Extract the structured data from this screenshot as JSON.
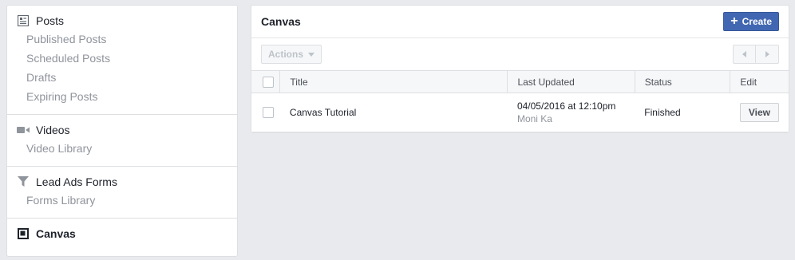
{
  "sidebar": {
    "sections": [
      {
        "icon": "posts-icon",
        "label": "Posts",
        "items": [
          "Published Posts",
          "Scheduled Posts",
          "Drafts",
          "Expiring Posts"
        ]
      },
      {
        "icon": "video-camera-icon",
        "label": "Videos",
        "items": [
          "Video Library"
        ]
      },
      {
        "icon": "funnel-icon",
        "label": "Lead Ads Forms",
        "items": [
          "Forms Library"
        ]
      },
      {
        "icon": "canvas-icon",
        "label": "Canvas",
        "items": []
      }
    ]
  },
  "main": {
    "title": "Canvas",
    "create_label": "Create",
    "actions_label": "Actions",
    "table": {
      "columns": [
        "Title",
        "Last Updated",
        "Status",
        "Edit"
      ],
      "rows": [
        {
          "title": "Canvas Tutorial",
          "updated": "04/05/2016 at 12:10pm",
          "author": "Moni Ka",
          "status": "Finished",
          "action": "View"
        }
      ]
    }
  },
  "colors": {
    "primary": "#4267b2",
    "background": "#e9eaed",
    "muted": "#90949c"
  }
}
